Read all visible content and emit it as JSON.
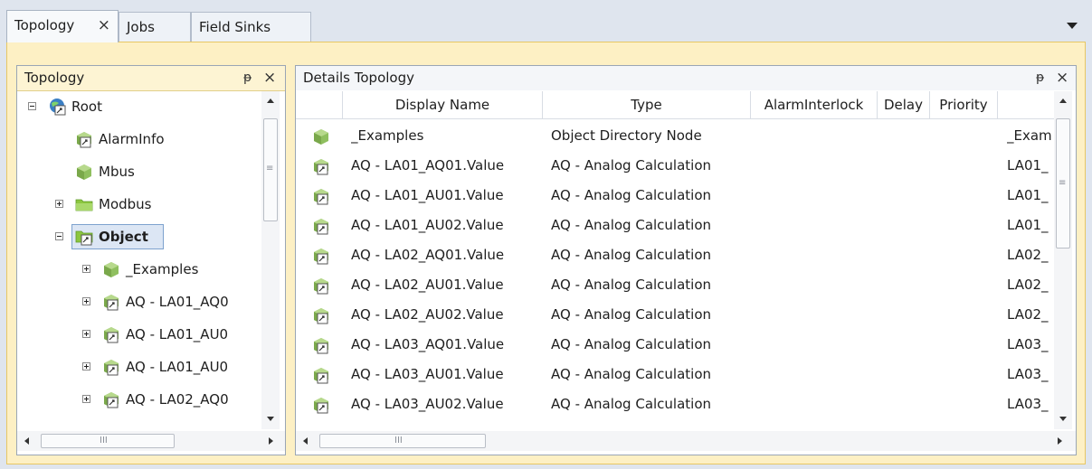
{
  "tabs": [
    {
      "label": "Topology",
      "active": true,
      "closable": true
    },
    {
      "label": "Jobs",
      "active": false,
      "closable": false
    },
    {
      "label": "Field Sinks",
      "active": false,
      "closable": false
    }
  ],
  "icons": {
    "close": "×",
    "pin": "ᵽ",
    "grip": "≡",
    "hscroll_grip": "III"
  },
  "tree_panel": {
    "title": "Topology",
    "items": [
      {
        "label": "Root",
        "icon": "root-object-icon",
        "expander": "minus"
      },
      {
        "label": "AlarmInfo",
        "icon": "calculation-cube-icon",
        "expander": "none"
      },
      {
        "label": "Mbus",
        "icon": "green-cube-icon",
        "expander": "none"
      },
      {
        "label": "Modbus",
        "icon": "folder-icon",
        "expander": "plus"
      },
      {
        "label": "Object",
        "icon": "object-folder-icon",
        "expander": "minus",
        "selected": true
      },
      {
        "label": "_Examples",
        "icon": "green-cube-icon",
        "expander": "plus"
      },
      {
        "label": "AQ - LA01_AQ0",
        "icon": "calculation-cube-icon",
        "expander": "plus"
      },
      {
        "label": "AQ - LA01_AU0",
        "icon": "calculation-cube-icon",
        "expander": "plus"
      },
      {
        "label": "AQ - LA01_AU0",
        "icon": "calculation-cube-icon",
        "expander": "plus"
      },
      {
        "label": "AQ - LA02_AQ0",
        "icon": "calculation-cube-icon",
        "expander": "plus"
      }
    ]
  },
  "details_panel": {
    "title": "Details Topology",
    "columns": [
      "Display Name",
      "Type",
      "AlarmInterlock",
      "Delay",
      "Priority",
      ""
    ],
    "rows": [
      {
        "icon": "green-cube-icon",
        "name": "_Examples",
        "type": "Object Directory Node",
        "extra": "_Exam"
      },
      {
        "icon": "calculation-cube-icon",
        "name": "AQ - LA01_AQ01.Value",
        "type": "AQ - Analog Calculation",
        "extra": "LA01_"
      },
      {
        "icon": "calculation-cube-icon",
        "name": "AQ - LA01_AU01.Value",
        "type": "AQ - Analog Calculation",
        "extra": "LA01_"
      },
      {
        "icon": "calculation-cube-icon",
        "name": "AQ - LA01_AU02.Value",
        "type": "AQ - Analog Calculation",
        "extra": "LA01_"
      },
      {
        "icon": "calculation-cube-icon",
        "name": "AQ - LA02_AQ01.Value",
        "type": "AQ - Analog Calculation",
        "extra": "LA02_"
      },
      {
        "icon": "calculation-cube-icon",
        "name": "AQ - LA02_AU01.Value",
        "type": "AQ - Analog Calculation",
        "extra": "LA02_"
      },
      {
        "icon": "calculation-cube-icon",
        "name": "AQ - LA02_AU02.Value",
        "type": "AQ - Analog Calculation",
        "extra": "LA02_"
      },
      {
        "icon": "calculation-cube-icon",
        "name": "AQ - LA03_AQ01.Value",
        "type": "AQ - Analog Calculation",
        "extra": "LA03_"
      },
      {
        "icon": "calculation-cube-icon",
        "name": "AQ - LA03_AU01.Value",
        "type": "AQ - Analog Calculation",
        "extra": "LA03_"
      },
      {
        "icon": "calculation-cube-icon",
        "name": "AQ - LA03_AU02.Value",
        "type": "AQ - Analog Calculation",
        "extra": "LA03_"
      }
    ]
  },
  "colors": {
    "active_frame": "#fdf0c4",
    "active_border": "#e7c764",
    "selection": "#dce6f4",
    "cube_green": "#8fbf5f"
  }
}
